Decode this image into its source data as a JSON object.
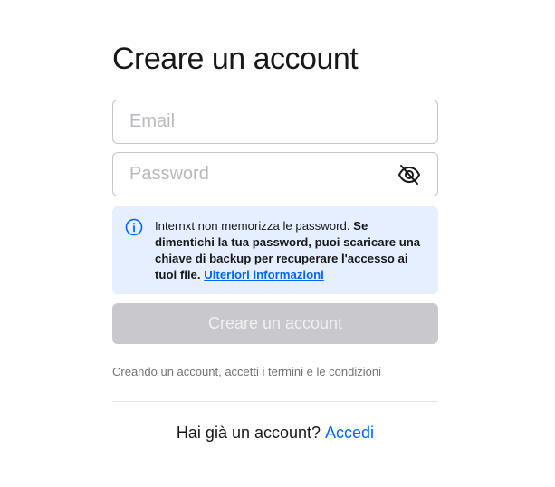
{
  "page": {
    "title": "Creare un account"
  },
  "form": {
    "email": {
      "placeholder": "Email",
      "value": ""
    },
    "password": {
      "placeholder": "Password",
      "value": "",
      "toggle_icon": "eye-off-icon"
    },
    "info": {
      "icon": "info-icon",
      "text_plain": "Internxt non memorizza le password. ",
      "text_bold": "Se dimentichi la tua password, puoi scaricare una chiave di backup per recuperare l'accesso ai tuoi file.",
      "link_label": "Ulteriori informazioni"
    },
    "submit_label": "Creare un account",
    "terms": {
      "prefix": "Creando un account, ",
      "link_label": "accetti i termini e le condizioni"
    }
  },
  "footer": {
    "question": "Hai già un account?",
    "login_label": "Accedi"
  },
  "colors": {
    "accent": "#0066ff",
    "info_background": "#e6efff",
    "button_disabled": "#c8c8cd",
    "border": "#c4c4c9"
  }
}
